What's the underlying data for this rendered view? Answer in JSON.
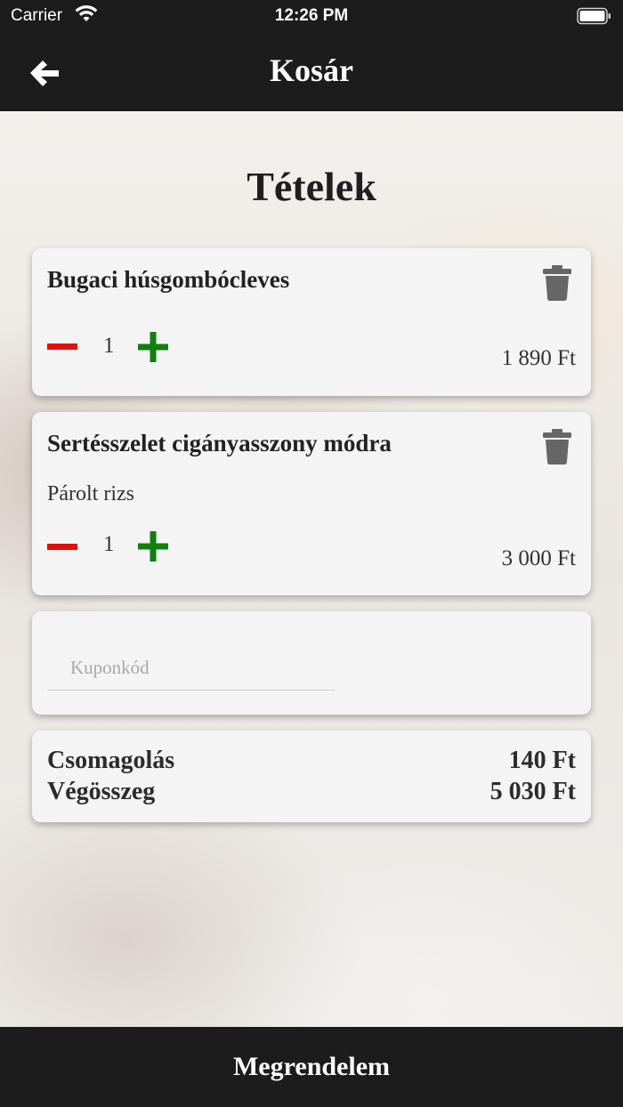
{
  "status_bar": {
    "carrier": "Carrier",
    "time": "12:26 PM"
  },
  "nav": {
    "title": "Kosár",
    "back_icon": "arrow-left-icon"
  },
  "section_title": "Tételek",
  "items": [
    {
      "name": "Bugaci húsgombócleves",
      "option": "",
      "quantity": "1",
      "price": "1 890 Ft"
    },
    {
      "name": "Sertésszelet cigányasszony módra",
      "option": "Párolt rizs",
      "quantity": "1",
      "price": "3 000 Ft"
    }
  ],
  "coupon": {
    "placeholder": "Kuponkód",
    "value": ""
  },
  "summary": {
    "packaging_label": "Csomagolás",
    "packaging_value": "140 Ft",
    "total_label": "Végösszeg",
    "total_value": "5 030 Ft"
  },
  "order_button": "Megrendelem",
  "colors": {
    "bar": "#1c1c1c",
    "minus": "#e01010",
    "plus": "#108010",
    "trash": "#666666",
    "card": "#f4f4f4"
  }
}
